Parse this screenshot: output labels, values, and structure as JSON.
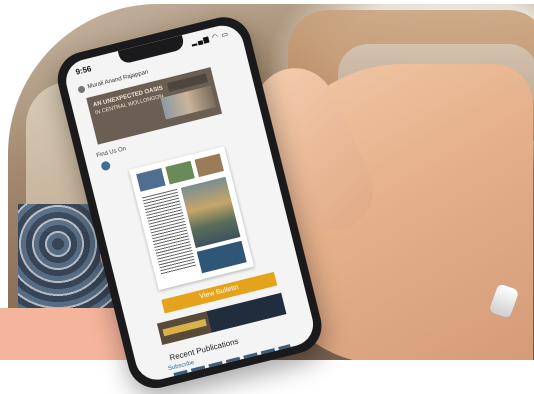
{
  "status": {
    "time": "9:56",
    "icons": "▂▄▆ ◠ ▭"
  },
  "user": {
    "name": "Murali Anand Rajappan"
  },
  "ad_top": {
    "line1": "AN UNEXPECTED OASIS",
    "line2": "IN CENTRAL WOLLONGON"
  },
  "section": {
    "find_us": "Find Us On"
  },
  "bulletin": {
    "button_label": "View Bulletin"
  },
  "publications": {
    "title": "Recent Publications",
    "subscribe": "Subscribe"
  }
}
